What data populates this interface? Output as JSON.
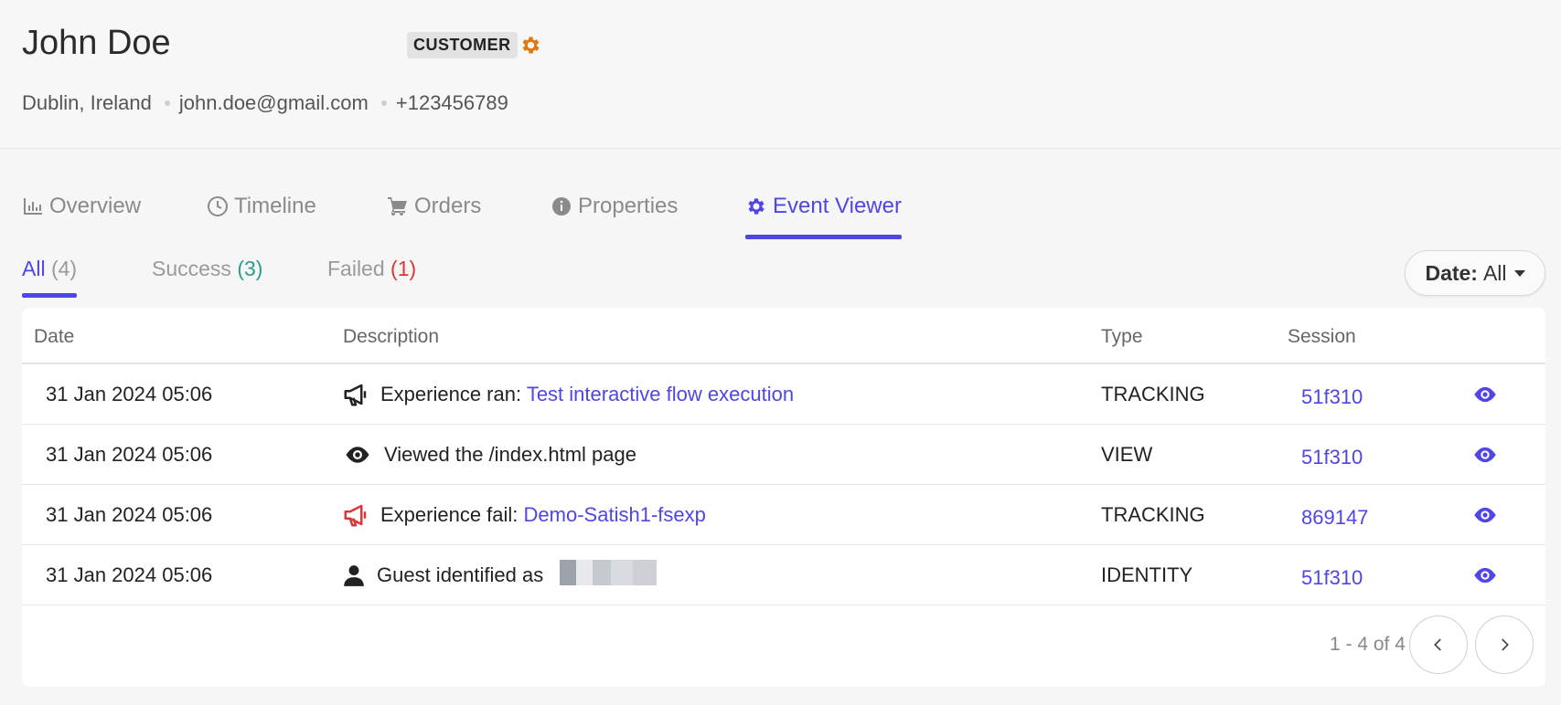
{
  "profile": {
    "name": "John Doe",
    "badge": "CUSTOMER",
    "location": "Dublin, Ireland",
    "email": "john.doe@gmail.com",
    "phone": "+123456789"
  },
  "tabs": [
    {
      "label": "Overview",
      "icon": "bar-chart-icon"
    },
    {
      "label": "Timeline",
      "icon": "clock-icon"
    },
    {
      "label": "Orders",
      "icon": "cart-icon"
    },
    {
      "label": "Properties",
      "icon": "info-icon"
    },
    {
      "label": "Event Viewer",
      "icon": "gear-icon",
      "active": true
    }
  ],
  "subtabs": {
    "all": {
      "label": "All",
      "count": "(4)"
    },
    "success": {
      "label": "Success",
      "count": "(3)"
    },
    "failed": {
      "label": "Failed",
      "count": "(1)"
    }
  },
  "date_filter": {
    "label": "Date:",
    "value": "All"
  },
  "table": {
    "headers": {
      "date": "Date",
      "description": "Description",
      "type": "Type",
      "session": "Session"
    },
    "rows": [
      {
        "date": "31 Jan 2024 05:06",
        "icon": "megaphone-icon",
        "text": "Experience ran:",
        "link": "Test interactive flow execution",
        "type": "TRACKING",
        "session": "51f310"
      },
      {
        "date": "31 Jan 2024 05:06",
        "icon": "eye-icon",
        "text": "Viewed the /index.html page",
        "link": "",
        "type": "VIEW",
        "session": "51f310"
      },
      {
        "date": "31 Jan 2024 05:06",
        "icon": "megaphone-red-icon",
        "text": "Experience fail:",
        "link": "Demo-Satish1-fsexp",
        "type": "TRACKING",
        "session": "869147"
      },
      {
        "date": "31 Jan 2024 05:06",
        "icon": "user-icon",
        "text": "Guest identified as",
        "link": "",
        "type": "IDENTITY",
        "session": "51f310"
      }
    ]
  },
  "pagination": {
    "text": "1 - 4 of 4"
  },
  "colors": {
    "accent": "#4f46e5",
    "success": "#2a9d8f",
    "failed": "#d93838",
    "badge_gear": "#e07a10"
  }
}
